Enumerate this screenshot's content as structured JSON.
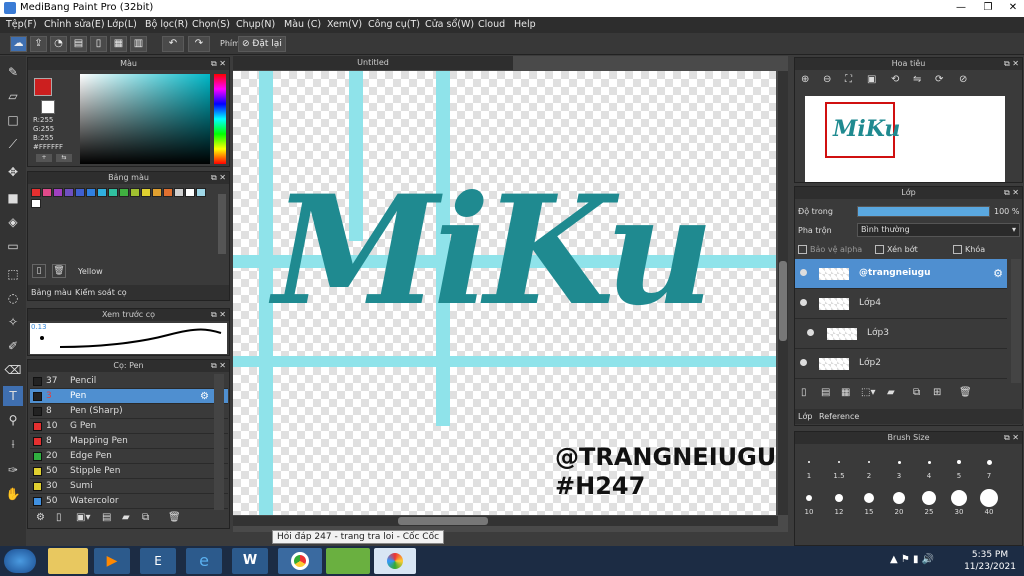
{
  "window": {
    "title": "MediBang Paint Pro (32bit)",
    "minimize": "—",
    "restore": "❐",
    "close": "✕"
  },
  "menu": [
    "Tệp(F)",
    "Chỉnh sửa(E)",
    "Lớp(L)",
    "Bộ lọc(R)",
    "Chọn(S)",
    "Chụp(N)",
    "Màu (C)",
    "Xem(V)",
    "Công cụ(T)",
    "Cửa sổ(W)",
    "Cloud",
    "Help"
  ],
  "toolbar": {
    "key_label": "Phím",
    "reset_label": "Đặt lại"
  },
  "color_panel": {
    "title": "Màu",
    "r": "R:255",
    "g": "G:255",
    "b": "B:255",
    "hex": "#FFFFFF",
    "primary_color": "#cc1f1f"
  },
  "palette_panel": {
    "title": "Bảng màu",
    "selected_name": "Yellow",
    "tab1": "Bảng màu",
    "tab2": "Kiểm soát cọ",
    "colors": [
      "#e53030",
      "#e04a8a",
      "#a040c0",
      "#7050c0",
      "#4060d0",
      "#3080e0",
      "#30b0e0",
      "#30c0a0",
      "#40b040",
      "#a0c030",
      "#e0d030",
      "#e0a030",
      "#e07030",
      "#d0d0d0",
      "#ffffff",
      "#a0d8e8",
      "#ffffff"
    ]
  },
  "brush_preview": {
    "title": "Xem trước cọ",
    "size": "0.13"
  },
  "brush_panel": {
    "title": "Cọ: Pen",
    "items": [
      {
        "size": "37",
        "name": "Pencil",
        "color": "#222222"
      },
      {
        "size": "3",
        "name": "Pen",
        "color": "#222222"
      },
      {
        "size": "8",
        "name": "Pen (Sharp)",
        "color": "#222222"
      },
      {
        "size": "10",
        "name": "G Pen",
        "color": "#e53030"
      },
      {
        "size": "8",
        "name": "Mapping Pen",
        "color": "#e53030"
      },
      {
        "size": "20",
        "name": "Edge Pen",
        "color": "#30b040"
      },
      {
        "size": "50",
        "name": "Stipple Pen",
        "color": "#e0d030"
      },
      {
        "size": "30",
        "name": "Sumi",
        "color": "#e0d030"
      },
      {
        "size": "50",
        "name": "Watercolor",
        "color": "#4090e0"
      }
    ]
  },
  "document": {
    "title": "Untitled",
    "artwork_title": "MiKu",
    "artwork_handle": "@TRANGNEIUGU",
    "artwork_tag": "#H247"
  },
  "navigator": {
    "title": "Hoa tiêu"
  },
  "layer_panel": {
    "title": "Lớp",
    "opacity_label": "Độ trong",
    "opacity_value": "100 %",
    "opacity": 1.0,
    "blend_label": "Pha trộn",
    "blend_value": "Bình thường",
    "protect_alpha": "Bảo vệ alpha",
    "clipping": "Xén bớt",
    "lock": "Khóa",
    "layers": [
      "@trangneiugu",
      "Lớp4",
      "Lớp3",
      "Lớp2"
    ],
    "tab1": "Lớp",
    "tab2": "Reference"
  },
  "brush_size_panel": {
    "title": "Brush Size",
    "row1": [
      "1",
      "1.5",
      "2",
      "3",
      "4",
      "5",
      "7"
    ],
    "row2": [
      "10",
      "12",
      "15",
      "20",
      "25",
      "30",
      "40"
    ]
  },
  "taskbar": {
    "tooltip": "Hỏi đáp 247 - trang tra loi - Cốc Cốc",
    "time": "5:35 PM",
    "date": "11/23/2021"
  }
}
